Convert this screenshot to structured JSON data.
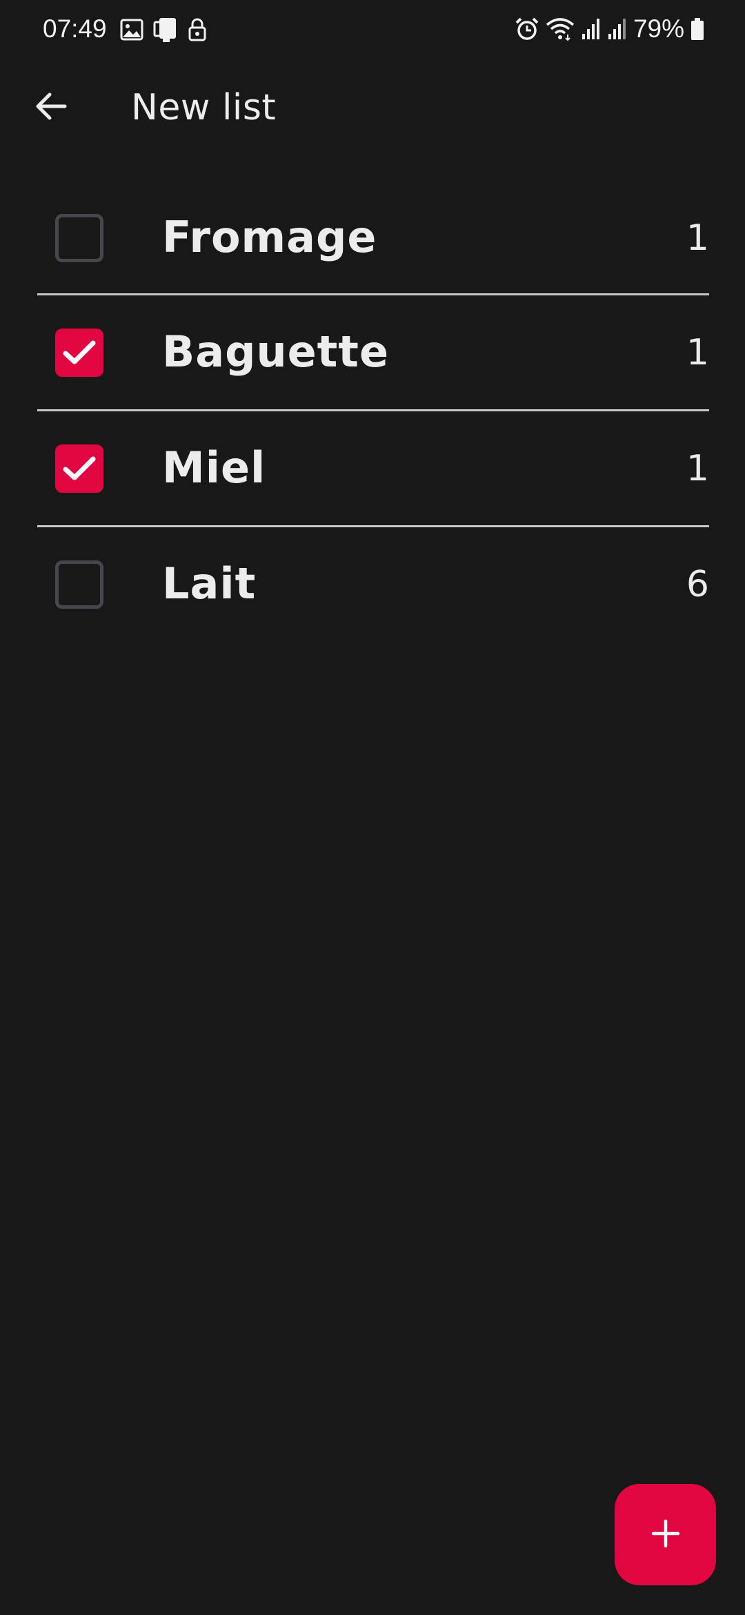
{
  "status_bar": {
    "time": "07:49",
    "left_icons": [
      "image-icon",
      "device-sync-icon",
      "lock-icon"
    ],
    "right_icons": [
      "alarm-icon",
      "wifi-icon",
      "signal-icon",
      "signal-icon"
    ],
    "battery_percent": "79%"
  },
  "app_bar": {
    "title": "New list",
    "back_icon": "arrow-left-icon"
  },
  "items": [
    {
      "name": "Fromage",
      "quantity": "1",
      "checked": false
    },
    {
      "name": "Baguette",
      "quantity": "1",
      "checked": true
    },
    {
      "name": "Miel",
      "quantity": "1",
      "checked": true
    },
    {
      "name": "Lait",
      "quantity": "6",
      "checked": false
    }
  ],
  "fab": {
    "icon": "plus-icon"
  },
  "colors": {
    "background": "#181818",
    "accent": "#e10640",
    "unchecked_border": "#46464c",
    "divider": "#c9c9c9",
    "text": "#ececec"
  }
}
